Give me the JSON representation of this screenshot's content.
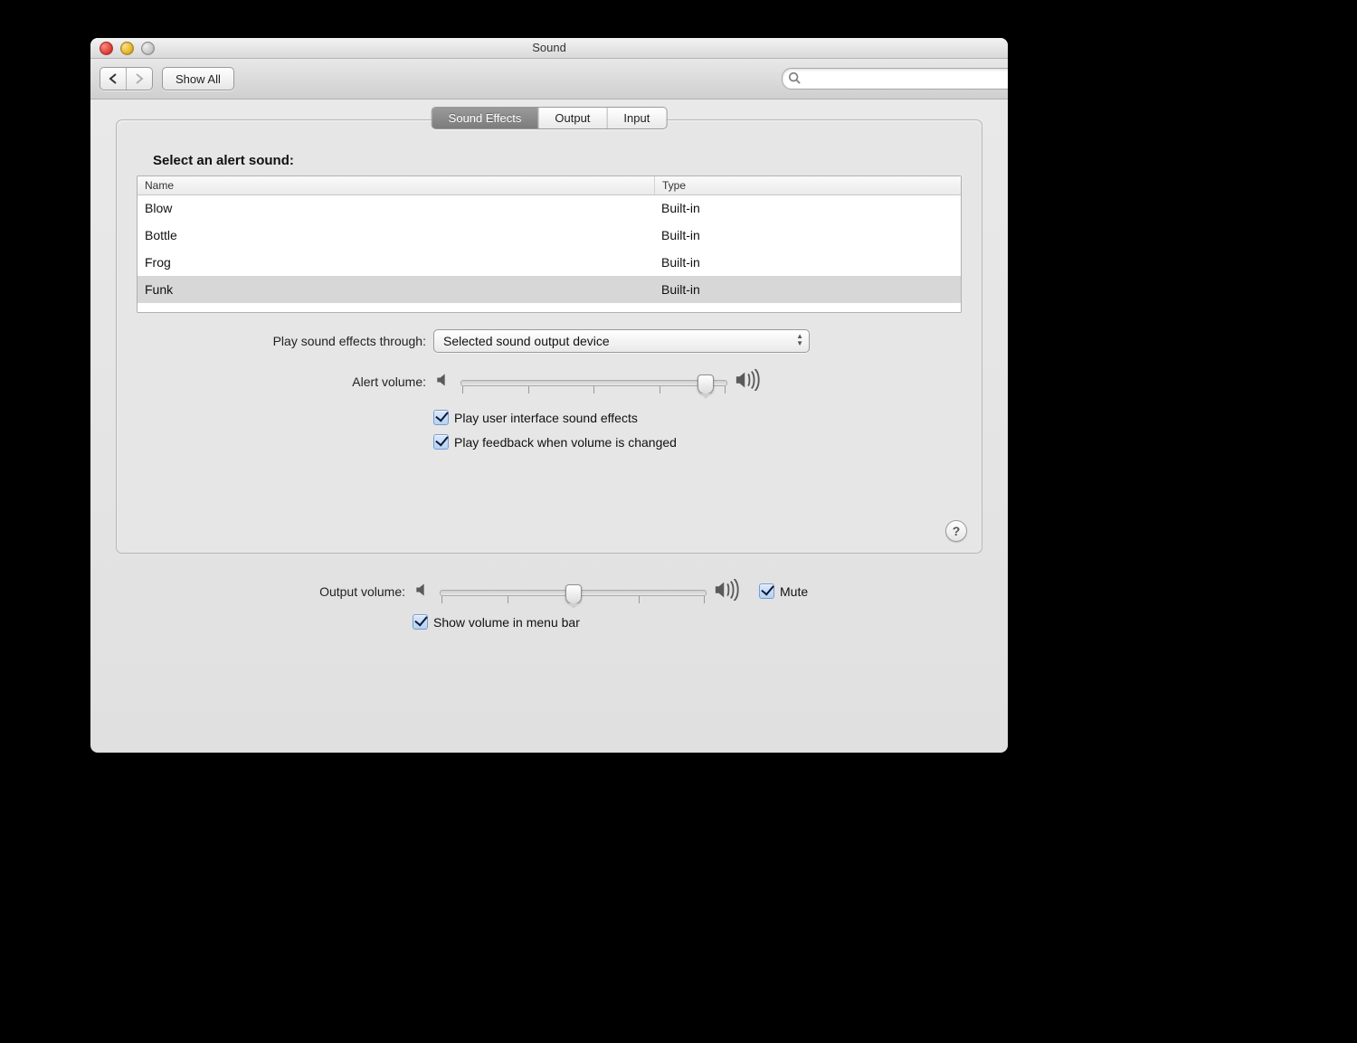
{
  "window": {
    "title": "Sound"
  },
  "toolbar": {
    "show_all_label": "Show All",
    "search_placeholder": ""
  },
  "tabs": {
    "sound_effects": "Sound Effects",
    "output": "Output",
    "input": "Input",
    "active": "sound_effects"
  },
  "panel": {
    "heading": "Select an alert sound:",
    "columns": {
      "name": "Name",
      "type": "Type"
    },
    "sounds": [
      {
        "name": "Blow",
        "type": "Built-in",
        "selected": false
      },
      {
        "name": "Bottle",
        "type": "Built-in",
        "selected": false
      },
      {
        "name": "Frog",
        "type": "Built-in",
        "selected": false
      },
      {
        "name": "Funk",
        "type": "Built-in",
        "selected": true
      }
    ],
    "play_through_label": "Play sound effects through:",
    "play_through_value": "Selected sound output device",
    "alert_volume_label": "Alert volume:",
    "alert_volume_percent": 92,
    "check_ui_sounds": "Play user interface sound effects",
    "check_feedback": "Play feedback when volume is changed",
    "help": "?"
  },
  "bottom": {
    "output_volume_label": "Output volume:",
    "output_volume_percent": 50,
    "mute_label": "Mute",
    "show_menu_label": "Show volume in menu bar"
  }
}
